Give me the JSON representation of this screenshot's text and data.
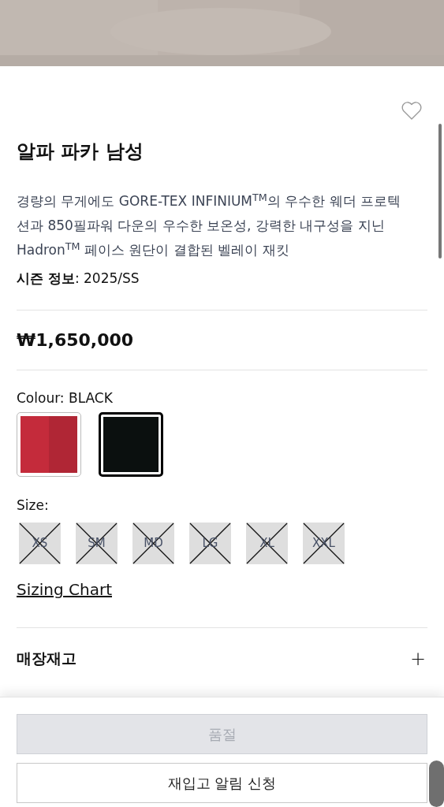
{
  "product": {
    "title": "알파 파카 남성",
    "favorite": false,
    "description": "경량의 무게에도 GORE-TEX INFINIUM$^{TM}$의 우수한 웨더 프로텍션과 850필파워 다운의 우수한 보온성, 강력한 내구성을 지닌 Hadron$^{TM}$ 페이스 원단이 결합된 벨레이 재킷",
    "season": "**시즌 정보**: 2025/SS",
    "price": "₩1,650,000"
  },
  "colour": {
    "label": "Colour: BLACK",
    "swatches": [
      {
        "color": "#c42b3b",
        "selected": false
      },
      {
        "color": "#0b100f",
        "selected": true
      }
    ]
  },
  "size": {
    "label": "Size:",
    "options": [
      {
        "label": "XS",
        "available": false
      },
      {
        "label": "SM",
        "available": false
      },
      {
        "label": "MD",
        "available": false
      },
      {
        "label": "LG",
        "available": false
      },
      {
        "label": "XL",
        "available": false
      },
      {
        "label": "XXL",
        "available": false
      }
    ]
  },
  "sizing_chart": "Sizing Chart",
  "accordion": {
    "label": "매장재고",
    "icon": "+",
    "expanded": false
  },
  "buttons": [
    {
      "label": "품절",
      "disabled": true
    },
    {
      "label": "재입고 알림 신청",
      "disabled": false
    }
  ]
}
